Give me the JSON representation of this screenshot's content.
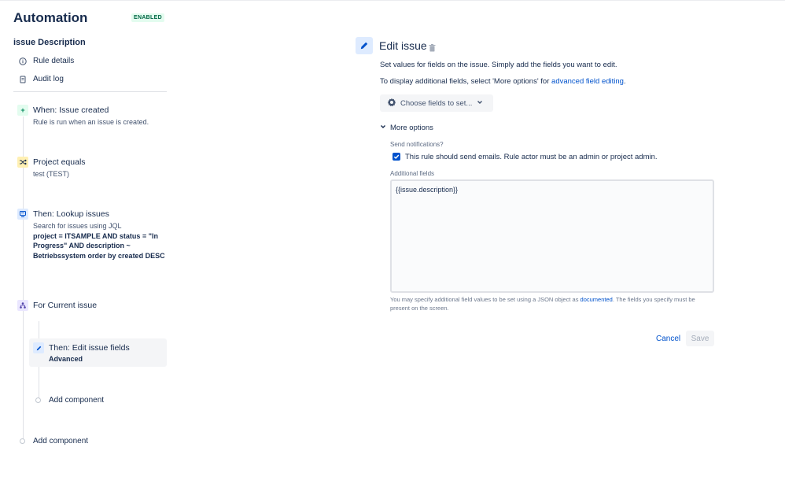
{
  "app": {
    "title": "Automation",
    "status_badge": "ENABLED"
  },
  "rule": {
    "name": "issue Description"
  },
  "nav": {
    "rule_details": "Rule details",
    "audit_log": "Audit log"
  },
  "steps": [
    {
      "icon": "plus-icon",
      "title": "When: Issue created",
      "subtitle": "Rule is run when an issue is created."
    },
    {
      "icon": "shuffle-icon",
      "title": "Project equals",
      "subtitle": "test (TEST)"
    },
    {
      "icon": "lookup-icon",
      "title": "Then: Lookup issues",
      "subtitle": "Search for issues using JQL",
      "jql": "project = ITSAMPLE AND status = \"In Progress\" AND description ~ Betriebssystem order by created DESC"
    },
    {
      "icon": "branch-icon",
      "title": "For Current issue"
    },
    {
      "icon": "pencil-icon",
      "title": "Then: Edit issue fields",
      "subtitle": "Advanced"
    }
  ],
  "add_component_inner": "Add component",
  "add_component_outer": "Add component",
  "main": {
    "title": "Edit issue",
    "desc1": "Set values for fields on the issue. Simply add the fields you want to edit.",
    "desc2_prefix": "To display additional fields, select 'More options' for ",
    "desc2_link": "advanced field editing",
    "desc2_suffix": ".",
    "choose_fields": "Choose fields to set...",
    "more_options": "More options",
    "send_notifications_label": "Send notifications?",
    "send_notifications_checked": true,
    "send_notifications_text": "This rule should send emails. Rule actor must be an admin or project admin.",
    "additional_fields_label": "Additional fields",
    "additional_fields_value": "{{issue.description}}",
    "help_prefix": "You may specify additional field values to be set using a JSON object as ",
    "help_link": "documented",
    "help_suffix": ". The fields you specify must be present on the screen.",
    "cancel": "Cancel",
    "save": "Save"
  },
  "colors": {
    "primary": "#0052cc",
    "text": "#172b4d",
    "badge_bg": "#e3fcef",
    "badge_text": "#006644",
    "trigger_bg": "#e3fcef",
    "condition_bg": "#fff0b3",
    "action_bg": "#deebff",
    "branch_bg": "#eae6ff"
  }
}
